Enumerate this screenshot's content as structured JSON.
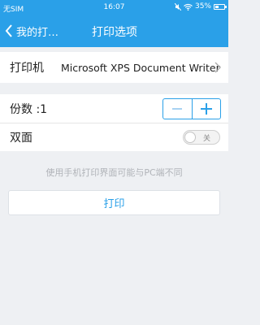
{
  "status_bar": {
    "carrier": "无SIM",
    "time": "16:07",
    "battery": "35%"
  },
  "title_bar": {
    "back_label": "我的打…",
    "title": "打印选项"
  },
  "printer": {
    "label": "打印机",
    "value": "Microsoft XPS Document Writer"
  },
  "copies": {
    "label": "份数 :1"
  },
  "duplex": {
    "label": "双面",
    "toggle_label": "关"
  },
  "hint": "使用手机打印界面可能与PC端不同",
  "print_button": "打印",
  "colors": {
    "accent": "#2aa0e8",
    "background": "#eef0f3"
  }
}
